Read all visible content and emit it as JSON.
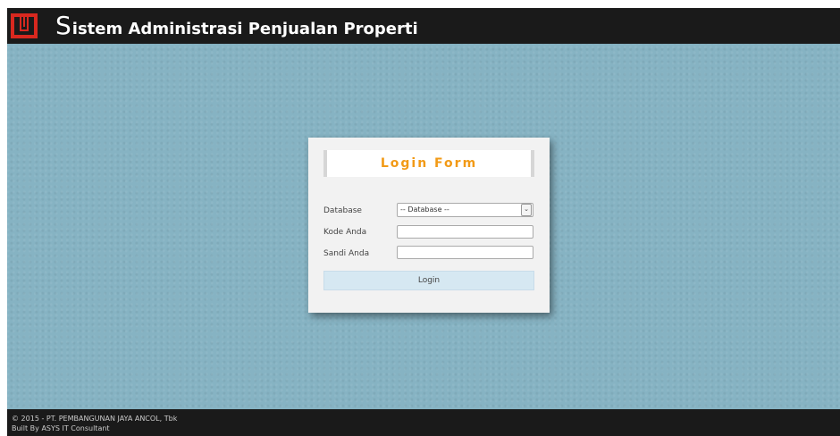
{
  "header": {
    "title_first_letter": "S",
    "title_rest": "istem Administrasi Penjualan Properti"
  },
  "login": {
    "title": "Login Form",
    "database_label": "Database",
    "database_value": "-- Database --",
    "kode_label": "Kode Anda",
    "kode_value": "",
    "sandi_label": "Sandi Anda",
    "sandi_value": "",
    "button_label": "Login"
  },
  "footer": {
    "copyright": "© 2015 - PT. PEMBANGUNAN JAYA ANCOL, Tbk",
    "built_by": "Built By ASYS IT Consultant"
  },
  "colors": {
    "background": "#86b3c3",
    "bars": "#1a1a1a",
    "logo": "#d8281f",
    "title_accent": "#f29a16",
    "button": "#d6e8f2"
  },
  "icons": {
    "logo": "company-logo-icon",
    "select_arrow": "chevron-down-icon"
  }
}
